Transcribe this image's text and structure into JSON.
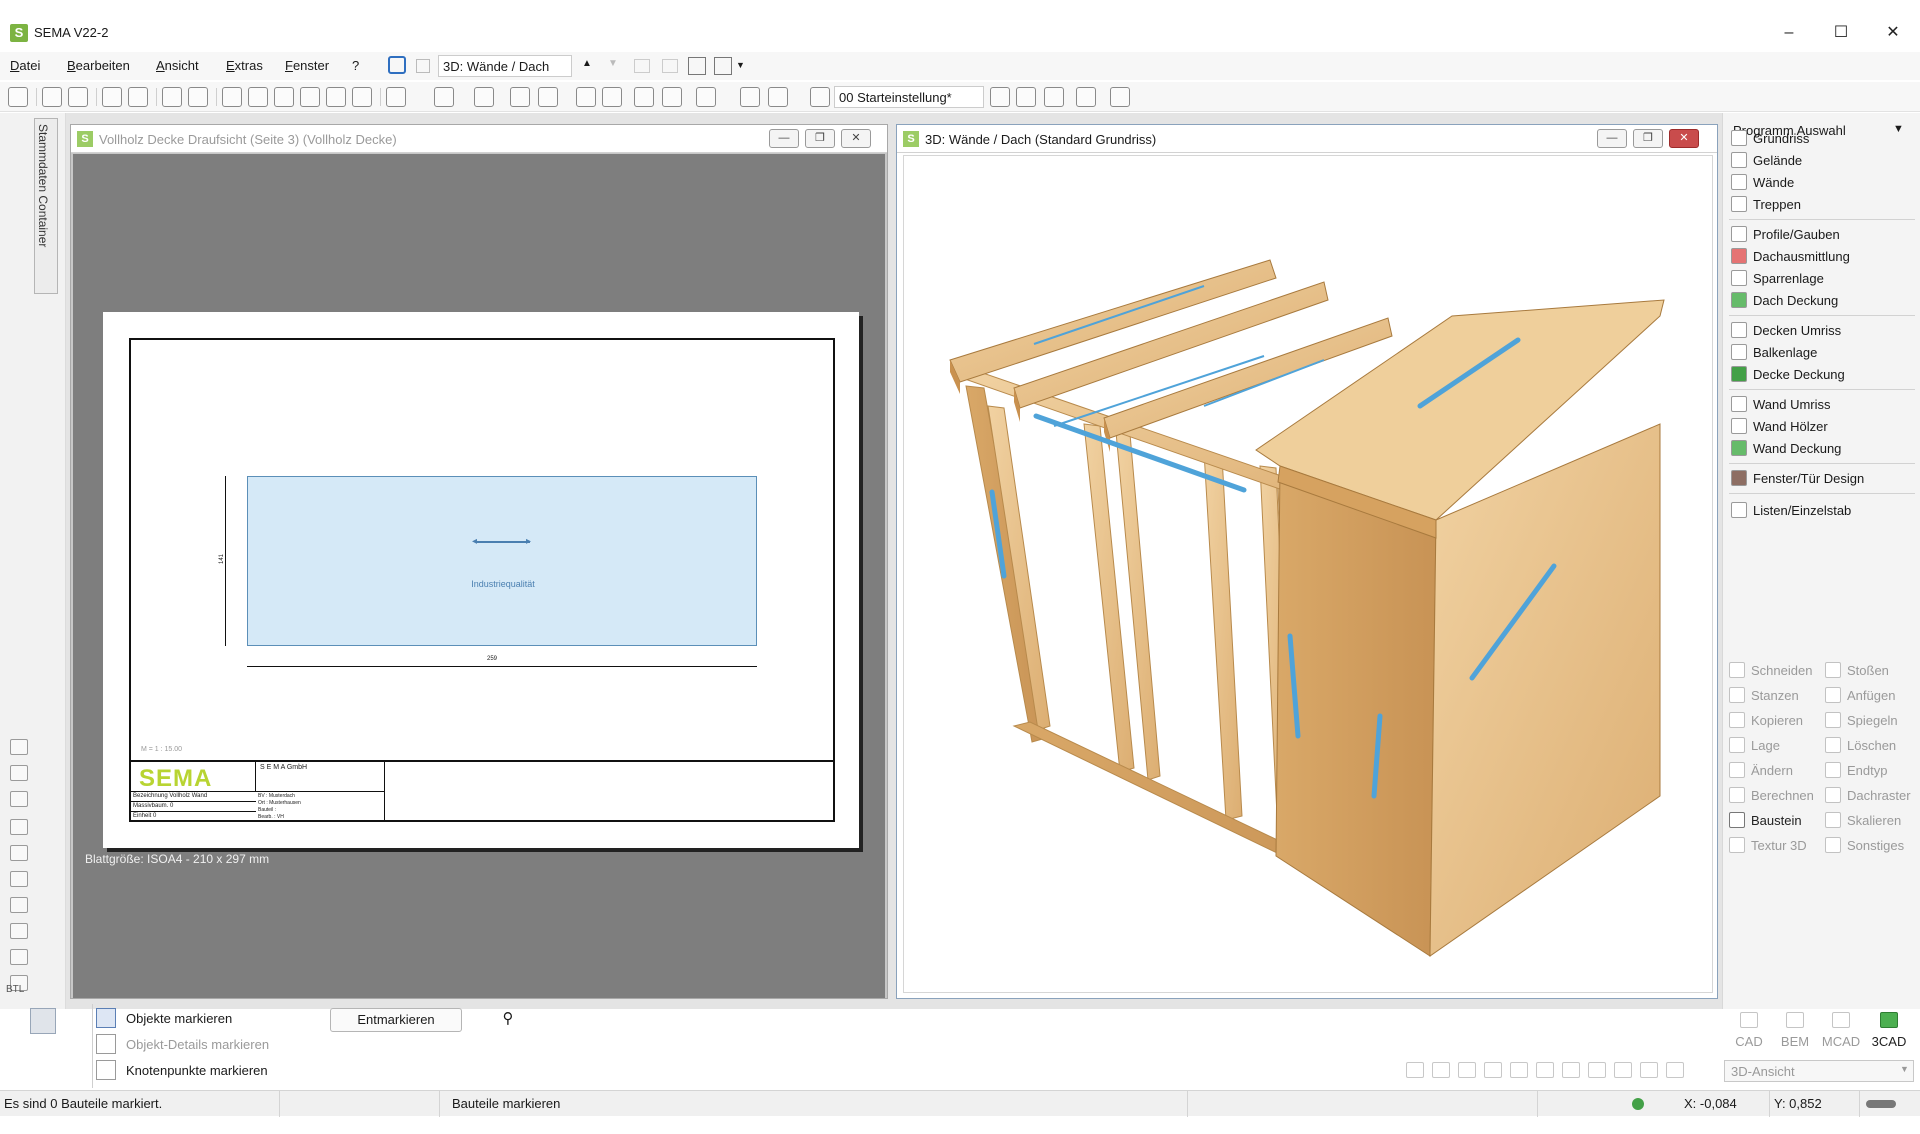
{
  "app": {
    "title": "SEMA V22-2",
    "logo_letter": "S"
  },
  "window_controls": {
    "minimize": "–",
    "maximize": "☐",
    "close": "✕"
  },
  "menu": {
    "items": [
      "Datei",
      "Bearbeiten",
      "Ansicht",
      "Extras",
      "Fenster",
      "?"
    ],
    "view_combo": "3D: Wände / Dach"
  },
  "toolbar": {
    "profile_combo": "00 Starteinstellung*"
  },
  "left_strip": {
    "container_label": "Stammdaten Container",
    "btl_label": "BTL"
  },
  "window_plan": {
    "title": "Vollholz Decke Draufsicht  (Seite 3) (Vollholz Decke)",
    "sheet_size": "Blattgröße: ISOA4 - 210 x 297 mm",
    "panel_label": "Industriequalität",
    "dim_horizontal": "259",
    "dim_vertical": "141",
    "scale_note": "M = 1 : 15.00",
    "titleblock": {
      "logo": "SEMA",
      "company": "S E M A GmbH",
      "rows_left": [
        "Bezeichnung   Vollholz Wand",
        "Massivbaum.  0",
        "Einheit        0"
      ],
      "rows_right": [
        "BV   :  Musterdach",
        "Ort   :  Musterhausen",
        "Bauteil :",
        "Bearb. :  VH"
      ]
    }
  },
  "window_3d": {
    "title": "3D: Wände / Dach (Standard Grundriss)"
  },
  "right_panel": {
    "header": "Programm Auswahl",
    "groups": [
      [
        "Grundriss",
        "Gelände",
        "Wände",
        "Treppen"
      ],
      [
        "Profile/Gauben",
        "Dachausmittlung",
        "Sparrenlage",
        "Dach Deckung"
      ],
      [
        "Decken Umriss",
        "Balkenlage",
        "Decke Deckung"
      ],
      [
        "Wand Umriss",
        "Wand Hölzer",
        "Wand Deckung"
      ],
      [
        "Fenster/Tür Design"
      ],
      [
        "Listen/Einzelstab"
      ]
    ],
    "tools_left": [
      "Schneiden",
      "Stanzen",
      "Kopieren",
      "Lage",
      "Ändern",
      "Berechnen",
      "Baustein",
      "Textur 3D"
    ],
    "tools_right": [
      "Stoßen",
      "Anfügen",
      "Spiegeln",
      "Löschen",
      "Endtyp",
      "Dachraster",
      "Skalieren",
      "Sonstiges"
    ],
    "modes": [
      "CAD",
      "BEM",
      "MCAD",
      "3CAD"
    ],
    "view_combo": "3D-Ansicht"
  },
  "mark_panel": {
    "rows": [
      "Objekte markieren",
      "Objekt-Details markieren",
      "Knotenpunkte markieren"
    ],
    "unmark_button": "Entmarkieren"
  },
  "statusbar": {
    "message": "Es sind 0 Bauteile markiert.",
    "mode": "Bauteile markieren",
    "x": "X: -0,084",
    "y": "Y: 0,852"
  },
  "colors": {
    "accent_green": "#7cb342",
    "panel_blue": "#d5e9f7",
    "close_red": "#c94c4c",
    "wood": "#e9c48f"
  }
}
